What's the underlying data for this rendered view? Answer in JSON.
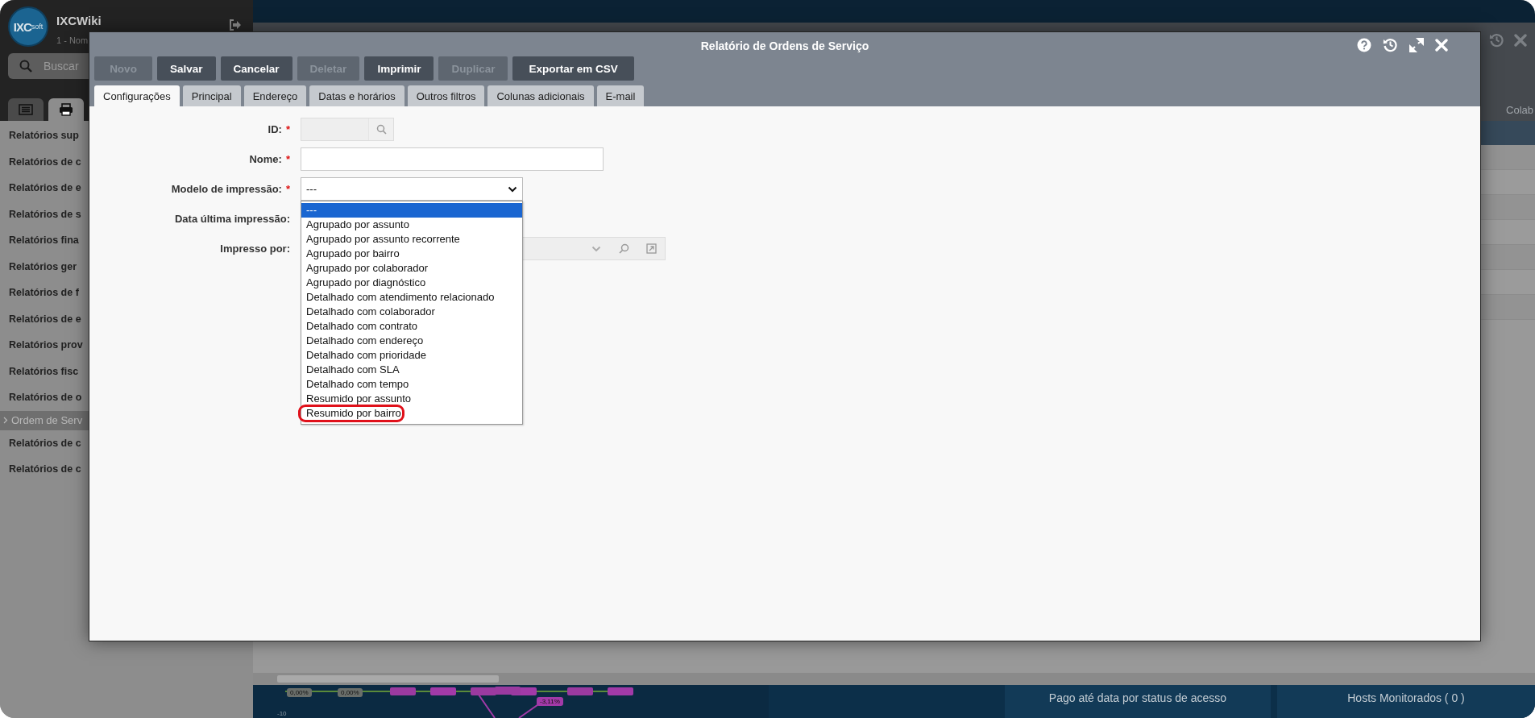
{
  "app": {
    "logo": {
      "main": "IXC",
      "sub": "soft"
    },
    "title": "IXCWiki",
    "subtitle": "1 - Nom",
    "search": {
      "placeholder": "Buscar"
    }
  },
  "sidebar": {
    "tabs": [
      {
        "kind": "list",
        "selected": false
      },
      {
        "kind": "printer",
        "selected": true
      }
    ],
    "items": [
      {
        "label": "Relatórios sup",
        "selected": false
      },
      {
        "label": "Relatórios de c",
        "selected": false
      },
      {
        "label": "Relatórios de e",
        "selected": false
      },
      {
        "label": "Relatórios de s",
        "selected": false
      },
      {
        "label": "Relatórios fina",
        "selected": false
      },
      {
        "label": "Relatórios ger",
        "selected": false
      },
      {
        "label": "Relatórios de f",
        "selected": false
      },
      {
        "label": "Relatórios de e",
        "selected": false
      },
      {
        "label": "Relatórios prov",
        "selected": false
      },
      {
        "label": "Relatórios fisc",
        "selected": false
      },
      {
        "label": "Relatórios de o",
        "selected": false
      },
      {
        "label": "Ordem de Serv",
        "selected": true
      },
      {
        "label": "Relatórios de c",
        "selected": false
      },
      {
        "label": "Relatórios de c",
        "selected": false
      }
    ]
  },
  "background": {
    "column_header": "Colab",
    "chart": {
      "badges": [
        {
          "text": "0,00%",
          "color": "#6a6e6a"
        },
        {
          "text": "0,00%",
          "color": "#6a6e6a"
        },
        {
          "text": "-3,11%",
          "color": "#a23aa8"
        }
      ],
      "axis_label": "-10"
    },
    "panels": [
      "Pago até data por status de acesso",
      "Hosts Monitorados ( 0 )"
    ]
  },
  "modal": {
    "title": "Relatório de Ordens de Serviço",
    "toolbar": [
      {
        "label": "Novo",
        "disabled": true
      },
      {
        "label": "Salvar",
        "disabled": false
      },
      {
        "label": "Cancelar",
        "disabled": false
      },
      {
        "label": "Deletar",
        "disabled": true
      },
      {
        "label": "Imprimir",
        "disabled": false
      },
      {
        "label": "Duplicar",
        "disabled": true
      },
      {
        "label": "Exportar em CSV",
        "disabled": false
      }
    ],
    "tabs": [
      {
        "label": "Configurações",
        "selected": true
      },
      {
        "label": "Principal",
        "selected": false
      },
      {
        "label": "Endereço",
        "selected": false
      },
      {
        "label": "Datas e horários",
        "selected": false
      },
      {
        "label": "Outros filtros",
        "selected": false
      },
      {
        "label": "Colunas adicionais",
        "selected": false
      },
      {
        "label": "E-mail",
        "selected": false
      }
    ],
    "form": {
      "required_mark": "*",
      "fields": [
        {
          "label": "ID:",
          "required": true,
          "kind": "search",
          "disabled": true
        },
        {
          "label": "Nome:",
          "required": true,
          "kind": "text"
        },
        {
          "label": "Modelo de impressão:",
          "required": true,
          "kind": "select",
          "value": "---",
          "expanded": true
        },
        {
          "label": "Data última impressão:",
          "required": false,
          "kind": "covered"
        },
        {
          "label": "Impresso por:",
          "required": false,
          "kind": "lookup"
        }
      ]
    },
    "dropdown": {
      "options": [
        {
          "label": "---",
          "selected": true,
          "outlined": false
        },
        {
          "label": "Agrupado por assunto",
          "selected": false,
          "outlined": false
        },
        {
          "label": "Agrupado por assunto recorrente",
          "selected": false,
          "outlined": false
        },
        {
          "label": "Agrupado por bairro",
          "selected": false,
          "outlined": false
        },
        {
          "label": "Agrupado por colaborador",
          "selected": false,
          "outlined": false
        },
        {
          "label": "Agrupado por diagnóstico",
          "selected": false,
          "outlined": false
        },
        {
          "label": "Detalhado com atendimento relacionado",
          "selected": false,
          "outlined": false
        },
        {
          "label": "Detalhado com colaborador",
          "selected": false,
          "outlined": false
        },
        {
          "label": "Detalhado com contrato",
          "selected": false,
          "outlined": false
        },
        {
          "label": "Detalhado com endereço",
          "selected": false,
          "outlined": false
        },
        {
          "label": "Detalhado com prioridade",
          "selected": false,
          "outlined": false
        },
        {
          "label": "Detalhado com SLA",
          "selected": false,
          "outlined": false
        },
        {
          "label": "Detalhado com tempo",
          "selected": false,
          "outlined": false
        },
        {
          "label": "Resumido por assunto",
          "selected": false,
          "outlined": false
        },
        {
          "label": "Resumido por bairro",
          "selected": false,
          "outlined": true
        }
      ]
    }
  }
}
